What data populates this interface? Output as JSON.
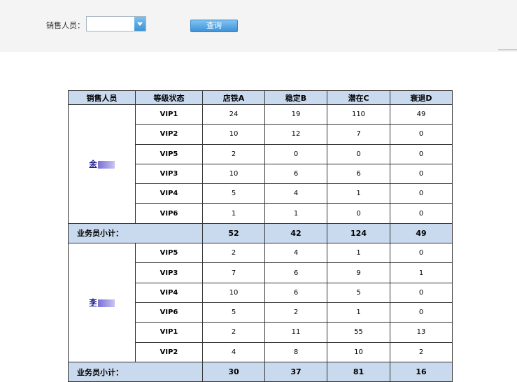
{
  "filter": {
    "label": "销售人员：",
    "select_value": "",
    "query_button": "查询"
  },
  "table": {
    "headers": [
      "销售人员",
      "等级状态",
      "店铁A",
      "稳定B",
      "潜在C",
      "衰退D"
    ],
    "groups": [
      {
        "person": "余",
        "rows": [
          {
            "level": "VIP1",
            "a": "24",
            "b": "19",
            "c": "110",
            "d": "49"
          },
          {
            "level": "VIP2",
            "a": "10",
            "b": "12",
            "c": "7",
            "d": "0"
          },
          {
            "level": "VIP5",
            "a": "2",
            "b": "0",
            "c": "0",
            "d": "0"
          },
          {
            "level": "VIP3",
            "a": "10",
            "b": "6",
            "c": "6",
            "d": "0"
          },
          {
            "level": "VIP4",
            "a": "5",
            "b": "4",
            "c": "1",
            "d": "0"
          },
          {
            "level": "VIP6",
            "a": "1",
            "b": "1",
            "c": "0",
            "d": "0"
          }
        ],
        "subtotal": {
          "label": "业务员小计：",
          "a": "52",
          "b": "42",
          "c": "124",
          "d": "49"
        }
      },
      {
        "person": "李",
        "rows": [
          {
            "level": "VIP5",
            "a": "2",
            "b": "4",
            "c": "1",
            "d": "0"
          },
          {
            "level": "VIP3",
            "a": "7",
            "b": "6",
            "c": "9",
            "d": "1"
          },
          {
            "level": "VIP4",
            "a": "10",
            "b": "6",
            "c": "5",
            "d": "0"
          },
          {
            "level": "VIP6",
            "a": "5",
            "b": "2",
            "c": "1",
            "d": "0"
          },
          {
            "level": "VIP1",
            "a": "2",
            "b": "11",
            "c": "55",
            "d": "13"
          },
          {
            "level": "VIP2",
            "a": "4",
            "b": "8",
            "c": "10",
            "d": "2"
          }
        ],
        "subtotal": {
          "label": "业务员小计：",
          "a": "30",
          "b": "37",
          "c": "81",
          "d": "16"
        }
      }
    ]
  }
}
